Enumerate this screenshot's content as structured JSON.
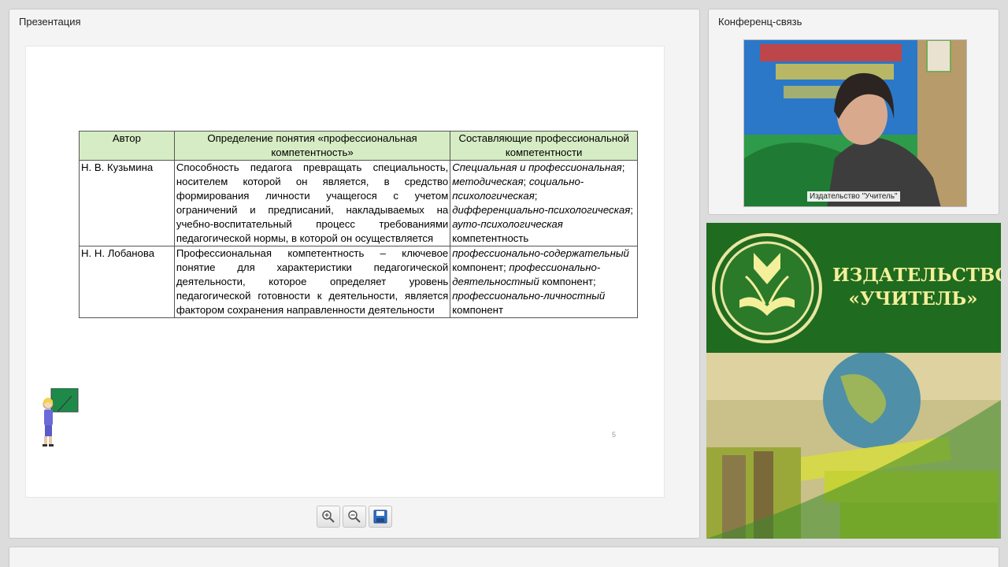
{
  "presentation": {
    "title": "Презентация",
    "page_number": "5",
    "table": {
      "headers": [
        "Автор",
        "Определение понятия «профессиональная компетентность»",
        "Составляющие профессиональной компетентности"
      ],
      "rows": [
        {
          "author": "Н. В. Кузьмина",
          "definition": "Способность педагога превращать специальность, носителем которой он является, в средство формирования личности учащегося с учетом ограничений и предписаний, накладываемых на учебно-воспитательный процесс требованиями педагогической нормы, в которой он осуществляется",
          "c1": "Специальная и профессиональная",
          "c1s": ";",
          "c2": "методическая",
          "c2s": "; ",
          "c3": "социально-психологическая",
          "c3s": ";",
          "c4": "дифференциально-психологическая",
          "c4s": "; ",
          "c5": "ауто-психологическая",
          "c6": "компетентность"
        },
        {
          "author": "Н. Н. Лобанова",
          "definition": "Профессиональная компетентность – ключевое понятие для характеристики педагогической деятельности, которое определяет уровень педагогической готовности к деятельности, является фактором сохранения направленности деятельности",
          "c1": "профессионально-содержательный",
          "c1s": " компонент;",
          "c2": "профессионально-деятельностный",
          "c2s": " компонент;",
          "c3": "профессионально-личностный",
          "c3s": " компонент"
        }
      ]
    },
    "toolbar": {
      "zoom_in_icon": "zoom-in-icon",
      "zoom_out_icon": "zoom-out-icon",
      "save_icon": "floppy-disk-icon"
    }
  },
  "conference": {
    "title": "Конференц-связь",
    "video_label": "Издательство \"Учитель\""
  },
  "banner": {
    "line1": "ИЗДАТЕЛЬСТВО",
    "line2": "«УЧИТЕЛЬ»"
  },
  "colors": {
    "table_header_bg": "#d6ecc4",
    "banner_green": "#1f6b1f",
    "banner_text": "#f3ef9a"
  }
}
